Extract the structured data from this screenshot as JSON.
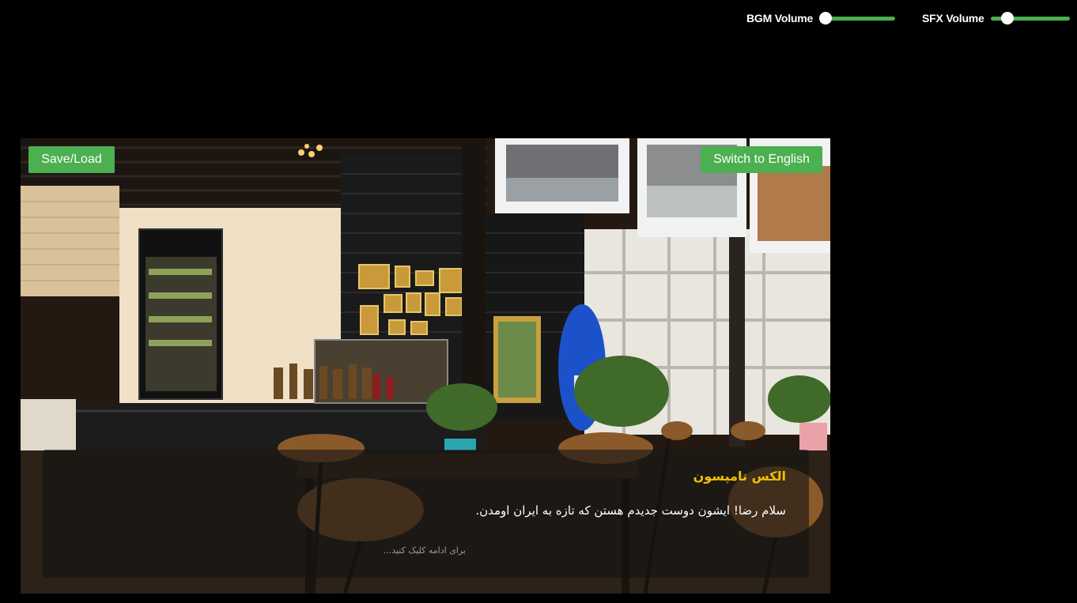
{
  "audio": {
    "bgm_label": "BGM Volume",
    "bgm_level": 0.0,
    "sfx_label": "SFX Volume",
    "sfx_level": 0.16,
    "accent_color": "#4caf50"
  },
  "toolbar": {
    "save_load_label": "Save/Load",
    "language_label": "Switch to English",
    "button_color": "#4caf50"
  },
  "scene": {
    "background": "cafe-interior"
  },
  "dialogue": {
    "speaker": "الکس تامپسون",
    "text": "سلام رضا! ایشون دوست جدیدم هستن که تازه به ایران اومدن.",
    "continue_hint": "برای ادامه کلیک کنید...",
    "speaker_color": "#f0c000"
  }
}
